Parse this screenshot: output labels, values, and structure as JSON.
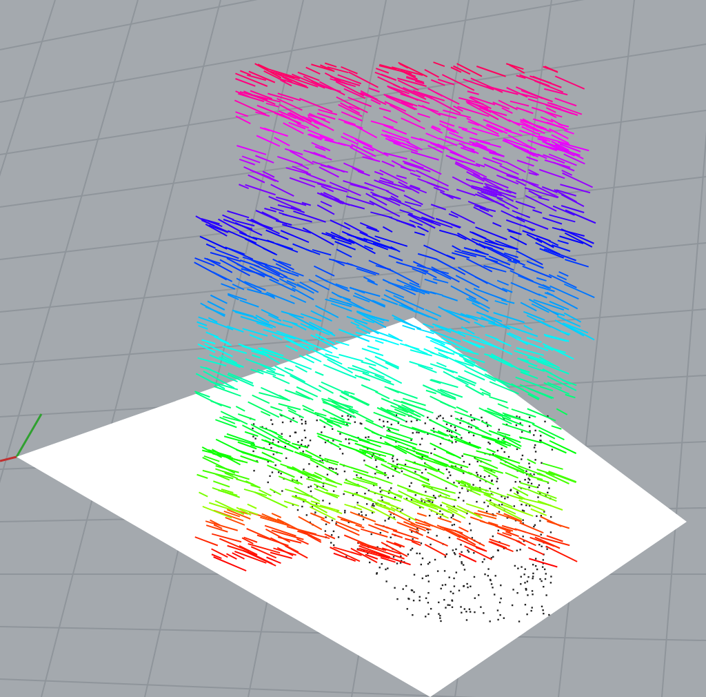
{
  "viewport": {
    "grid": true,
    "ground_plane": true,
    "axes": true
  }
}
